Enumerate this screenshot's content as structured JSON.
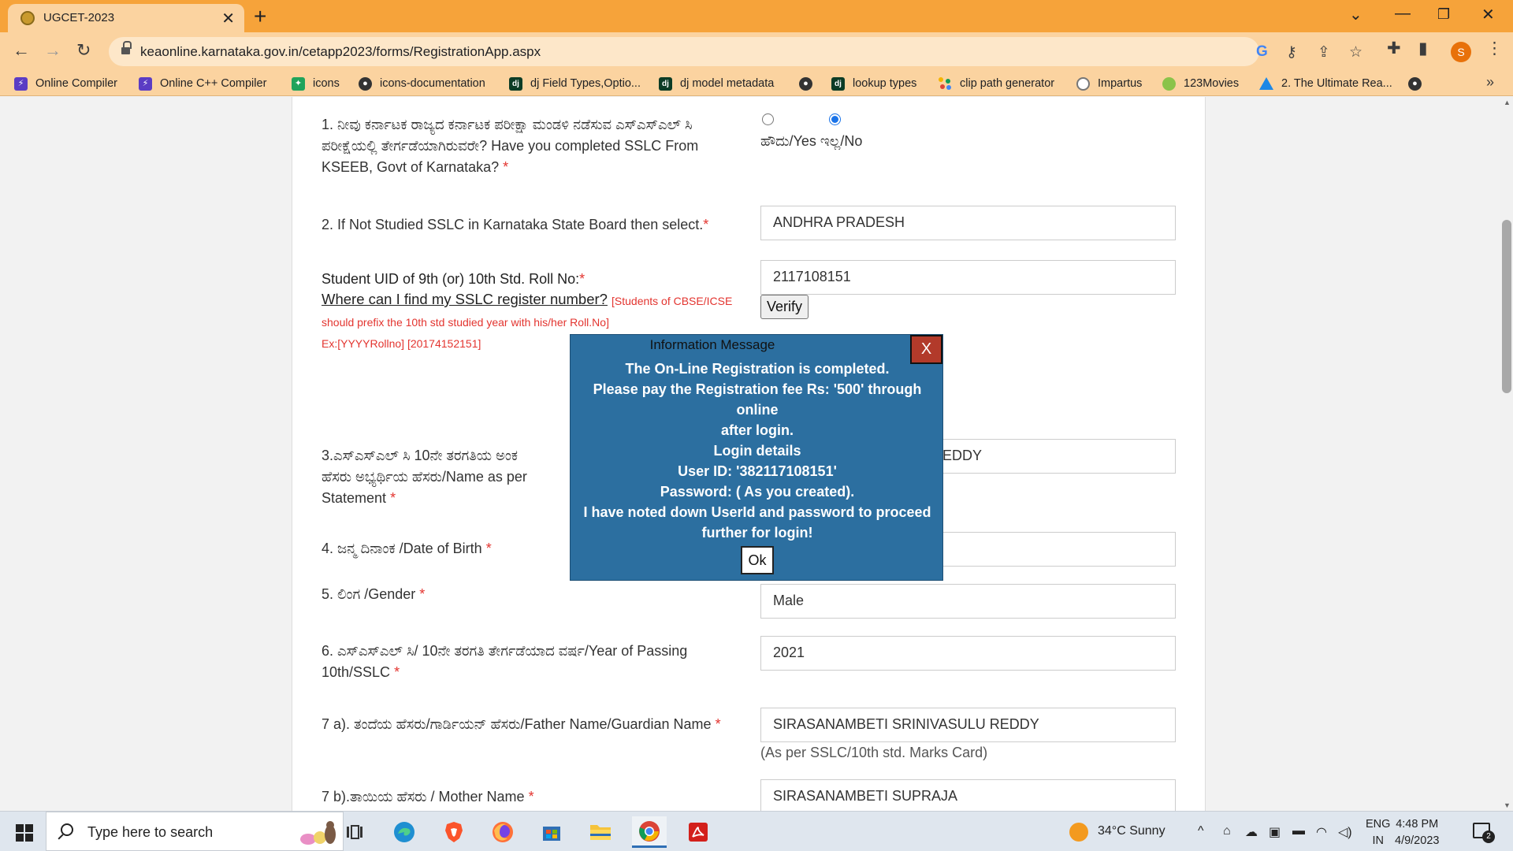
{
  "browser": {
    "tab_title": "UGCET-2023",
    "url": "keaonline.karnataka.gov.in/cetapp2023/forms/RegistrationApp.aspx",
    "profile_initial": "S",
    "bookmarks": [
      {
        "label": "Online Compiler",
        "icon": "lightning-icon"
      },
      {
        "label": "Online C++ Compiler",
        "icon": "lightning-icon"
      },
      {
        "label": "icons",
        "icon": "icons-app-icon"
      },
      {
        "label": "icons-documentation",
        "icon": "globe-icon"
      },
      {
        "label": "dj Field Types,Optio...",
        "icon": "django-icon"
      },
      {
        "label": "dj model metadata",
        "icon": "django-icon"
      },
      {
        "label": "",
        "icon": "globe-icon"
      },
      {
        "label": "lookup types",
        "icon": "django-icon"
      },
      {
        "label": "clip path generator",
        "icon": "dots-icon"
      },
      {
        "label": "Impartus",
        "icon": "circle-icon"
      },
      {
        "label": "123Movies",
        "icon": "film-icon"
      },
      {
        "label": "2. The Ultimate Rea...",
        "icon": "drive-icon"
      },
      {
        "label": "",
        "icon": "globe-icon"
      }
    ]
  },
  "form": {
    "q1": {
      "label": "1. ನೀವು ಕರ್ನಾಟಕ ರಾಜ್ಯದ ಕರ್ನಾಟಕ ಪರೀಕ್ಷಾ ಮಂಡಳಿ ನಡೆಸುವ ಎಸ್‌ಎಸ್‌ಎಲ್ ಸಿ ಪರೀಕ್ಷೆಯಲ್ಲಿ ತೇರ್ಗಡೆಯಾಗಿರುವರೇ? Have you completed SSLC From KSEEB, Govt of Karnataka?",
      "required": "*",
      "options_label": "ಹೌದು/Yes ಇಲ್ಲ/No",
      "selected": "No"
    },
    "q2": {
      "label": "2. If Not Studied SSLC in Karnataka State Board then select.",
      "required": "*",
      "value": "ANDHRA PRADESH"
    },
    "uid": {
      "label": "Student UID of 9th (or) 10th Std. Roll No:",
      "required": "*",
      "value": "2117108151",
      "link": "Where can I find my SSLC register number?",
      "note1": "[Students of CBSE/ICSE",
      "note2": "should prefix the 10th std studied year with his/her Roll.No]",
      "note3": "Ex:[YYYYRollno] [20174152151]",
      "verify": "Verify"
    },
    "q3": {
      "label_line1": "3.ಎಸ್‌ಎಸ್‌ಎಲ್ ಸಿ 10ನೇ ತರಗತಿಯ ಅಂಕ",
      "label_line2": "ಹೆಸರು ಅಭ್ಯರ್ಥಿಯ ಹೆಸರು/Name as per",
      "label_line3": "Statement",
      "required": "*",
      "value_visible": "EDDY"
    },
    "q4": {
      "label": "4. ಜನ್ಮ ದಿನಾಂಕ /Date of Birth",
      "required": "*",
      "value": ""
    },
    "q5": {
      "label": "5. ಲಿಂಗ /Gender",
      "required": "*",
      "value": "Male"
    },
    "q6": {
      "label": "6. ಎಸ್‌ಎಸ್‌ಎಲ್ ಸಿ/ 10ನೇ ತರಗತಿ ತೇರ್ಗಡೆಯಾದ ವರ್ಷ/Year of Passing 10th/SSLC",
      "required": "*",
      "value": "2021"
    },
    "q7a": {
      "label": "7 a). ತಂದೆಯ ಹೆಸರು/ಗಾರ್ಡಿಯನ್ ಹೆಸರು/Father Name/Guardian Name",
      "required": "*",
      "value": "SIRASANAMBETI SRINIVASULU REDDY",
      "helper": "(As per SSLC/10th std. Marks Card)"
    },
    "q7b": {
      "label": "7 b).ತಾಯಿಯ ಹೆಸರು / Mother Name",
      "required": "*",
      "value": "SIRASANAMBETI SUPRAJA"
    }
  },
  "modal": {
    "title": "Information Message",
    "close": "X",
    "lines": [
      "The On-Line Registration is completed.",
      "Please pay the Registration fee Rs: '500' through online",
      "after login.",
      "Login details",
      "User ID: '382117108151'",
      "Password: ( As you created).",
      "I have noted down UserId and password to proceed",
      "further for login!"
    ],
    "ok": "Ok"
  },
  "taskbar": {
    "search_placeholder": "Type here to search",
    "weather": "34°C  Sunny",
    "lang_line1": "ENG",
    "lang_line2": "IN",
    "time": "4:48 PM",
    "date": "4/9/2023",
    "notification_count": "2"
  },
  "colors": {
    "tabstrip": "#f6a33a",
    "toolbar": "#fbd3a0",
    "modal_bg": "#2c6fa0",
    "modal_close": "#b23a2a",
    "required": "#e3342f"
  }
}
